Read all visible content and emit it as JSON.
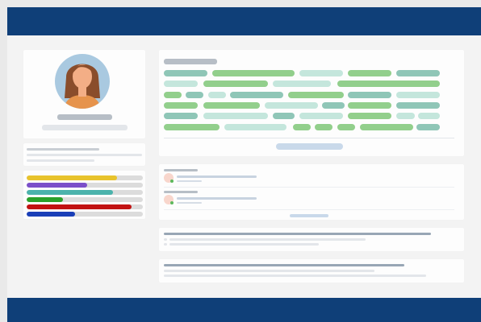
{
  "colors": {
    "header_blue": "#0f3f78",
    "avatar_bg": "#a9c9e0",
    "hair": "#8a4d2b",
    "skin": "#f3ae86",
    "shirt": "#e6934c",
    "tag_green": "#92cf8c",
    "tag_teal": "#8fc6b7",
    "tag_mint": "#c4e6dc",
    "tag_sage": "#b6e0b1",
    "status_dot": "#5cb85c",
    "link_blue": "#c9d9ea"
  },
  "profile": {
    "avatar_icon": "user-avatar-woman-icon"
  },
  "skills": [
    {
      "color": "#e8c32c",
      "level": 0.78
    },
    {
      "color": "#7b4fc9",
      "level": 0.52
    },
    {
      "color": "#4bb3ac",
      "level": 0.74
    },
    {
      "color": "#2aa12a",
      "level": 0.31
    },
    {
      "color": "#c21212",
      "level": 0.9
    },
    {
      "color": "#1a3fb8",
      "level": 0.42
    }
  ],
  "tags": {
    "rows": [
      [
        "teal",
        "green",
        "mint",
        "green",
        "teal"
      ],
      [
        "mint",
        "green",
        "mint",
        "green"
      ],
      [
        "green",
        "teal",
        "mint",
        "teal",
        "green",
        "teal",
        "mint"
      ],
      [
        "green",
        "green",
        "mint",
        "teal",
        "green",
        "teal"
      ],
      [
        "teal",
        "mint",
        "teal",
        "mint",
        "green",
        "mint",
        "mint"
      ],
      [
        "green",
        "mint",
        "green",
        "green",
        "green",
        "green",
        "teal"
      ]
    ]
  },
  "comments": [
    {
      "avatar_icon": "commenter-avatar-icon",
      "status_icon": "online-status-icon"
    },
    {
      "avatar_icon": "commenter-avatar-icon",
      "status_icon": "online-status-icon"
    }
  ]
}
